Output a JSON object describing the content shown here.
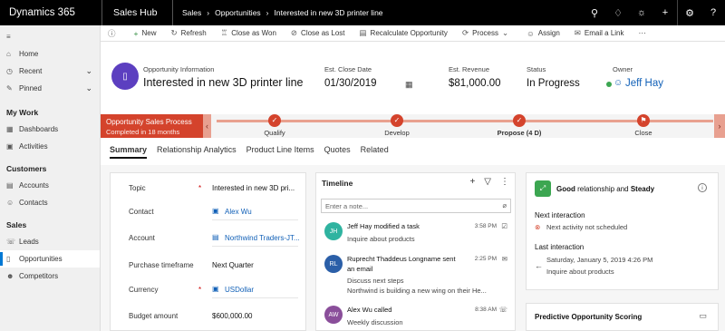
{
  "topbar": {
    "app_name": "Dynamics 365",
    "hub_name": "Sales Hub",
    "breadcrumb": [
      "Sales",
      "Opportunities",
      "Interested in new 3D printer line"
    ]
  },
  "sidebar": {
    "top_items": [
      {
        "icon": "home-icon",
        "label": "Home"
      },
      {
        "icon": "clock-icon",
        "label": "Recent"
      },
      {
        "icon": "pin-icon",
        "label": "Pinned"
      }
    ],
    "groups": [
      {
        "title": "My Work",
        "items": [
          {
            "icon": "dashboard-icon",
            "label": "Dashboards"
          },
          {
            "icon": "activities-icon",
            "label": "Activities"
          }
        ]
      },
      {
        "title": "Customers",
        "items": [
          {
            "icon": "accounts-icon",
            "label": "Accounts"
          },
          {
            "icon": "contacts-icon",
            "label": "Contacts"
          }
        ]
      },
      {
        "title": "Sales",
        "items": [
          {
            "icon": "leads-icon",
            "label": "Leads"
          },
          {
            "icon": "opportunities-icon",
            "label": "Opportunities"
          },
          {
            "icon": "competitors-icon",
            "label": "Competitors"
          }
        ]
      }
    ]
  },
  "commands": {
    "new": "New",
    "refresh": "Refresh",
    "close_won": "Close as Won",
    "close_lost": "Close as Lost",
    "recalc": "Recalculate Opportunity",
    "process": "Process",
    "assign": "Assign",
    "email_link": "Email a Link"
  },
  "header": {
    "entity_label": "Opportunity Information",
    "title": "Interested in new 3D printer line",
    "close_date_label": "Est. Close Date",
    "close_date": "01/30/2019",
    "revenue_label": "Est. Revenue",
    "revenue": "$81,000.00",
    "status_label": "Status",
    "status": "In Progress",
    "owner_label": "Owner",
    "owner": "Jeff Hay"
  },
  "process": {
    "name": "Opportunity Sales Process",
    "duration": "Completed in 18 months",
    "stages": [
      "Qualify",
      "Develop",
      "Propose (4 D)",
      "Close"
    ]
  },
  "tabs": [
    "Summary",
    "Relationship Analytics",
    "Product Line Items",
    "Quotes",
    "Related"
  ],
  "summary_fields": [
    {
      "label": "Topic",
      "required": "*",
      "value": "Interested in new 3D pri..."
    },
    {
      "label": "Contact",
      "required": "",
      "value": "Alex Wu"
    },
    {
      "label": "Account",
      "required": "",
      "value": "Northwind Traders-JT..."
    },
    {
      "label": "Purchase timeframe",
      "required": "",
      "value": "Next Quarter"
    },
    {
      "label": "Currency",
      "required": "*",
      "value": "USDollar"
    },
    {
      "label": "Budget amount",
      "required": "",
      "value": "$600,000.00"
    }
  ],
  "timeline": {
    "title": "Timeline",
    "note_placeholder": "Enter a note...",
    "items": [
      {
        "initials": "JH",
        "color": "#2fb3a0",
        "head": "Jeff Hay modified a task",
        "time": "3:58 PM",
        "lines": [
          "Inquire about products"
        ]
      },
      {
        "initials": "RL",
        "color": "#2b5fa8",
        "head": "Ruprecht Thaddeus Longname sent",
        "time": "2:25 PM",
        "lines": [
          "an email",
          "Discuss next steps",
          "Northwind is building a new wing on their He..."
        ]
      },
      {
        "initials": "AW",
        "color": "#8a4e9a",
        "head": "Alex Wu called",
        "time": "8:38 AM",
        "lines": [
          "Weekly discussion"
        ]
      }
    ]
  },
  "relationship": {
    "title_prefix": "Good",
    "title_mid": "relationship and",
    "title_suffix": "Steady",
    "next_label": "Next interaction",
    "next_value": "Next activity not scheduled",
    "last_label": "Last interaction",
    "last_date": "Saturday, January 5, 2019 4:26 PM",
    "last_subject": "Inquire about products"
  },
  "predictive": {
    "title": "Predictive Opportunity Scoring"
  },
  "colors": {
    "accent": "#d4432c",
    "link": "#1160b7",
    "avatar": "#5c3fc0"
  }
}
